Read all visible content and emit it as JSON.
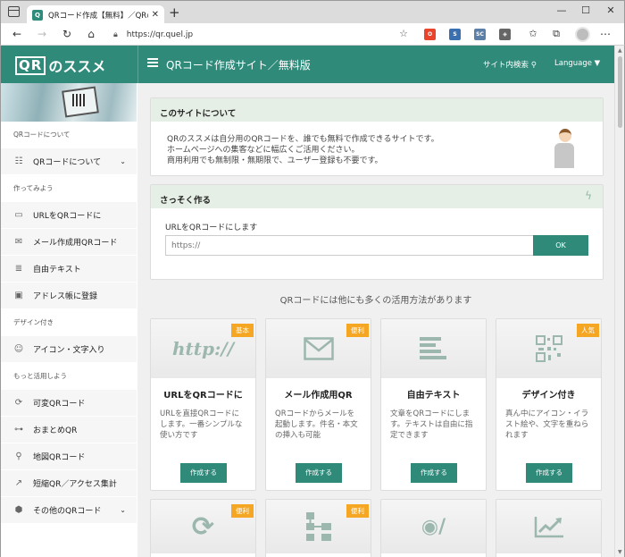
{
  "browser": {
    "tab_title": "QRコード作成【無料】／QRのススメ",
    "url": "https://qr.quel.jp"
  },
  "header": {
    "logo_qr": "QR",
    "logo_text": "のススメ",
    "title": "QRコード作成サイト／無料版",
    "search_label": "サイト内検索",
    "language_label": "Language"
  },
  "sidebar": {
    "sections": [
      {
        "label": "QRコードについて",
        "items": [
          {
            "label": "QRコードについて",
            "icon": "list-icon",
            "chevron": true
          }
        ]
      },
      {
        "label": "作ってみよう",
        "items": [
          {
            "label": "URLをQRコードに",
            "icon": "window-icon"
          },
          {
            "label": "メール作成用QRコード",
            "icon": "mail-icon"
          },
          {
            "label": "自由テキスト",
            "icon": "text-icon"
          },
          {
            "label": "アドレス帳に登録",
            "icon": "contact-icon"
          }
        ]
      },
      {
        "label": "デザイン付き",
        "items": [
          {
            "label": "アイコン・文字入り",
            "icon": "smile-icon"
          }
        ]
      },
      {
        "label": "もっと活用しよう",
        "items": [
          {
            "label": "可変QRコード",
            "icon": "refresh-icon"
          },
          {
            "label": "おまとめQR",
            "icon": "tree-icon"
          },
          {
            "label": "地図QRコード",
            "icon": "map-pin-icon"
          },
          {
            "label": "短縮QR／アクセス集計",
            "icon": "chart-icon"
          },
          {
            "label": "その他のQRコード",
            "icon": "box-icon",
            "chevron": true
          }
        ]
      }
    ]
  },
  "about": {
    "heading": "このサイトについて",
    "lines": [
      "QRのススメは自分用のQRコードを、誰でも無料で作成できるサイトです。",
      "ホームページへの集客などに幅広くご活用ください。",
      "商用利用でも無制限・無期限で、ユーザー登録も不要です。"
    ]
  },
  "quick": {
    "heading": "さっそく作る",
    "label": "URLをQRコードにします",
    "placeholder": "https://",
    "button": "OK"
  },
  "more_heading": "QRコードには他にも多くの活用方法があります",
  "features": [
    {
      "badge": "基本",
      "title": "URLをQRコードに",
      "desc": "URLを直接QRコードにします。一番シンプルな使い方です",
      "button": "作成する",
      "image_text": "http://"
    },
    {
      "badge": "便利",
      "title": "メール作成用QR",
      "desc": "QRコードからメールを起動します。件名・本文の挿入も可能",
      "button": "作成する"
    },
    {
      "badge": "",
      "title": "自由テキスト",
      "desc": "文章をQRコードにします。テキストは自由に指定できます",
      "button": "作成する"
    },
    {
      "badge": "人気",
      "title": "デザイン付き",
      "desc": "真ん中にアイコン・イラスト絵や、文字を重ねられます",
      "button": "作成する"
    }
  ],
  "features_row2": [
    {
      "badge": "便利",
      "icon": "refresh-icon"
    },
    {
      "badge": "便利",
      "icon": "flow-icon"
    },
    {
      "badge": "",
      "icon": "android-apple-icon"
    },
    {
      "badge": "",
      "icon": "trend-icon"
    }
  ],
  "colors": {
    "brand": "#2f8a7a",
    "badge": "#f5a623",
    "card_header": "#e6efe6"
  }
}
